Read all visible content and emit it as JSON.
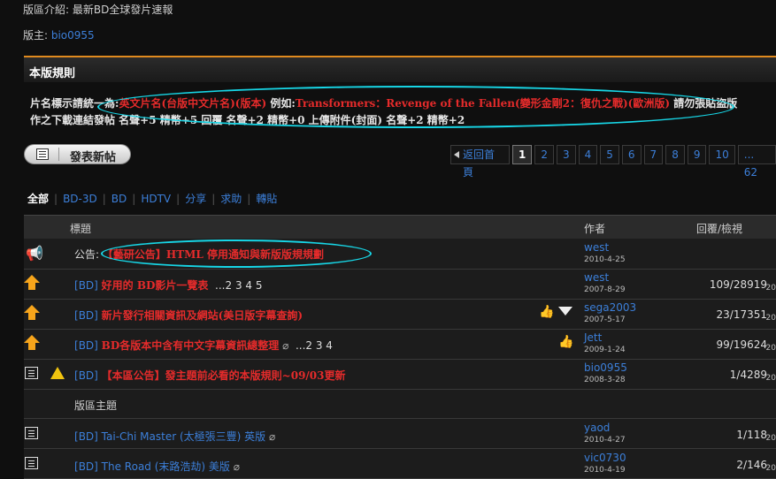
{
  "header": {
    "intro": "版區介紹: 最新BD全球發片速報",
    "moderator_label": "版主: ",
    "moderator_name": "bio0955"
  },
  "rules": {
    "title": "本版規則",
    "line1_a": "片名標示請統一為:",
    "line1_b": "英文片名(台版中文片名)(版本)",
    "line1_c": " 例如:",
    "line1_d": "Transformers：Revenge of the Fallen(變形金剛2：復仇之戰)(歐洲版)",
    "line1_e": " 請勿張貼盜版",
    "line2": "作之下載連結發帖 名聲+5 精幣+5 回覆 名聲+2 精幣+0 上傳附件(封面) 名聲+2 精幣+2"
  },
  "new_post_button": "發表新帖",
  "pager": {
    "back": "返回首頁",
    "pages": [
      "1",
      "2",
      "3",
      "4",
      "5",
      "6",
      "7",
      "8",
      "9",
      "10",
      "... 62"
    ],
    "current": "1"
  },
  "filters": [
    "全部",
    "BD-3D",
    "BD",
    "HDTV",
    "分享",
    "求助",
    "轉貼"
  ],
  "table_header": {
    "title": "標題",
    "author": "作者",
    "replies": "回覆/檢視"
  },
  "rows": [
    {
      "icon": "megaphone-icon",
      "prefix": "公告: ",
      "title": "【藝研公告】HTML 停用通知與新版版規規劃",
      "author": "west",
      "date": "2010-4-25",
      "stats": "",
      "edge": ""
    },
    {
      "icon": "sticky-arrow-icon",
      "tag": "BD",
      "title": "好用的 BD影片一覽表",
      "pages": "...2 3 4 5",
      "author": "west",
      "date": "2007-8-29",
      "stats": "109/28919",
      "edge": "20"
    },
    {
      "icon": "sticky-arrow-icon",
      "tag": "BD",
      "title": "新片發行相關資訊及網站(美日版字幕查詢)",
      "author": "sega2003",
      "date": "2007-5-17",
      "stats": "23/17351",
      "edge": "20"
    },
    {
      "icon": "sticky-arrow-icon",
      "tag": "BD",
      "title": "BD各版本中含有中文字幕資訊總整理",
      "pages": "...2 3 4",
      "author": "Jett",
      "date": "2009-1-24",
      "stats": "99/19624",
      "edge": "20"
    },
    {
      "icon": "closed-thread-icon",
      "tag": "BD",
      "title": "【本區公告】發主題前必看的本版規則~09/03更新",
      "author": "bio0955",
      "date": "2008-3-28",
      "stats": "1/4289",
      "edge": "20"
    },
    {
      "section": "版區主題"
    },
    {
      "icon": "thread-icon",
      "tag": "BD",
      "title": "Tai-Chi Master (太極張三豐) 英版",
      "author": "yaod",
      "date": "2010-4-27",
      "stats": "1/118",
      "edge": "20"
    },
    {
      "icon": "thread-icon",
      "tag": "BD",
      "title": "The Road (末路浩劫) 美版",
      "author": "vic0730",
      "date": "2010-4-19",
      "stats": "2/146",
      "edge": "20"
    }
  ]
}
